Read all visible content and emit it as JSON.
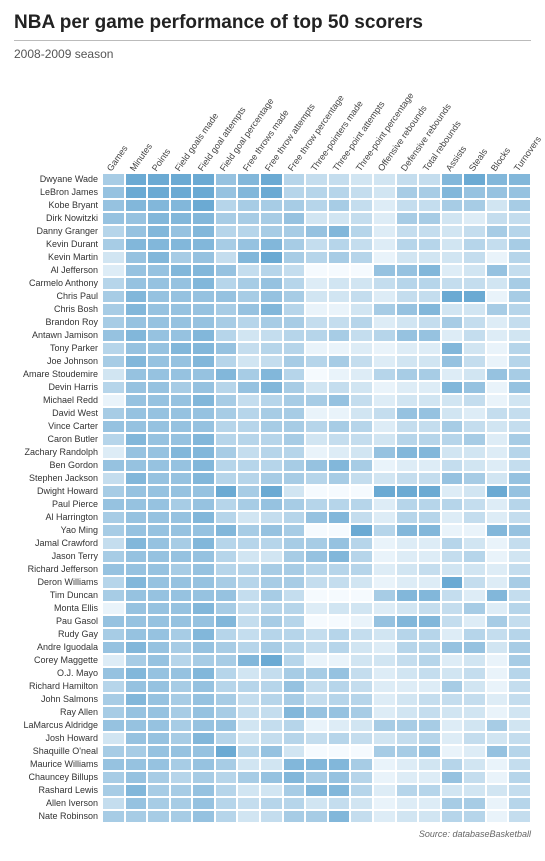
{
  "title": "NBA per game performance of top 50 scorers",
  "subtitle": "2008-2009 season",
  "source": "Source: databaseBasketball",
  "chart_data": {
    "type": "heatmap",
    "note": "Cell color encodes relative value within each column (darker = higher).",
    "value_scale": [
      0,
      1,
      2,
      3,
      4,
      5,
      6,
      7,
      8,
      9
    ],
    "colors": [
      "#f5fafe",
      "#e9f3fa",
      "#ddecf6",
      "#d1e5f2",
      "#c4ddee",
      "#b6d5ea",
      "#a7cce5",
      "#96c2e0",
      "#82b7da",
      "#6baad3"
    ],
    "columns": [
      "Games",
      "Minutes",
      "Points",
      "Field goals made",
      "Field goal attempts",
      "Field goal percentage",
      "Free throws made",
      "Free throw attempts",
      "Free throw percentage",
      "Three-pointers made",
      "Three-point attempts",
      "Three-point percentage",
      "Offensive rebounds",
      "Defensive rebounds",
      "Total rebounds",
      "Assists",
      "Steals",
      "Blocks",
      "Turnovers"
    ],
    "rows": [
      "Dwyane Wade",
      "LeBron James",
      "Kobe Bryant",
      "Dirk Nowitzki",
      "Danny Granger",
      "Kevin Durant",
      "Kevin Martin",
      "Al Jefferson",
      "Carmelo Anthony",
      "Chris Paul",
      "Chris Bosh",
      "Brandon Roy",
      "Antawn Jamison",
      "Tony Parker",
      "Joe Johnson",
      "Amare Stoudemire",
      "Devin Harris",
      "Michael Redd",
      "David West",
      "Vince Carter",
      "Caron Butler",
      "Zachary Randolph",
      "Ben Gordon",
      "Stephen Jackson",
      "Dwight Howard",
      "Paul Pierce",
      "Al Harrington",
      "Yao Ming",
      "Jamal Crawford",
      "Jason Terry",
      "Richard Jefferson",
      "Deron Williams",
      "Tim Duncan",
      "Monta Ellis",
      "Pau Gasol",
      "Rudy Gay",
      "Andre Iguodala",
      "Corey Maggette",
      "O.J. Mayo",
      "Richard Hamilton",
      "John Salmons",
      "Ray Allen",
      "LaMarcus Aldridge",
      "Josh Howard",
      "Shaquille O'neal",
      "Maurice Williams",
      "Chauncey Billups",
      "Rashard Lewis",
      "Allen Iverson",
      "Nate Robinson"
    ],
    "matrix": [
      [
        6,
        9,
        9,
        9,
        9,
        7,
        8,
        9,
        5,
        4,
        4,
        3,
        3,
        4,
        4,
        8,
        9,
        8,
        8
      ],
      [
        7,
        9,
        9,
        9,
        9,
        7,
        8,
        9,
        5,
        5,
        5,
        4,
        3,
        6,
        6,
        8,
        7,
        7,
        7
      ],
      [
        7,
        8,
        8,
        8,
        9,
        5,
        6,
        6,
        6,
        5,
        6,
        4,
        2,
        4,
        4,
        6,
        6,
        3,
        6
      ],
      [
        7,
        7,
        8,
        8,
        8,
        6,
        6,
        6,
        7,
        3,
        3,
        4,
        2,
        6,
        6,
        3,
        2,
        4,
        4
      ],
      [
        5,
        7,
        8,
        7,
        8,
        5,
        5,
        6,
        6,
        7,
        8,
        5,
        2,
        4,
        4,
        3,
        4,
        6,
        5
      ],
      [
        6,
        8,
        8,
        8,
        8,
        6,
        7,
        8,
        6,
        4,
        5,
        4,
        2,
        5,
        5,
        3,
        5,
        4,
        6
      ],
      [
        3,
        7,
        8,
        6,
        7,
        4,
        8,
        9,
        6,
        5,
        6,
        5,
        1,
        3,
        3,
        3,
        4,
        1,
        5
      ],
      [
        2,
        7,
        7,
        8,
        8,
        7,
        4,
        5,
        4,
        0,
        0,
        0,
        7,
        7,
        8,
        2,
        3,
        7,
        4
      ],
      [
        5,
        7,
        7,
        7,
        8,
        5,
        6,
        7,
        5,
        2,
        3,
        3,
        4,
        5,
        5,
        4,
        4,
        3,
        6
      ],
      [
        6,
        8,
        7,
        7,
        7,
        7,
        6,
        7,
        6,
        3,
        3,
        4,
        2,
        4,
        4,
        9,
        9,
        1,
        6
      ],
      [
        6,
        8,
        7,
        7,
        7,
        6,
        7,
        8,
        5,
        1,
        1,
        3,
        6,
        7,
        8,
        3,
        3,
        6,
        5
      ],
      [
        6,
        7,
        7,
        7,
        7,
        6,
        5,
        6,
        6,
        4,
        4,
        5,
        2,
        3,
        4,
        6,
        4,
        2,
        4
      ],
      [
        7,
        8,
        7,
        7,
        8,
        5,
        3,
        4,
        5,
        5,
        6,
        4,
        5,
        7,
        7,
        2,
        4,
        2,
        3
      ],
      [
        5,
        7,
        7,
        8,
        8,
        7,
        4,
        5,
        5,
        1,
        1,
        2,
        1,
        2,
        2,
        8,
        3,
        1,
        5
      ],
      [
        6,
        8,
        7,
        7,
        8,
        5,
        3,
        4,
        6,
        5,
        6,
        4,
        2,
        3,
        3,
        7,
        4,
        1,
        5
      ],
      [
        3,
        7,
        7,
        7,
        7,
        8,
        6,
        8,
        5,
        0,
        1,
        2,
        5,
        6,
        6,
        2,
        3,
        7,
        6
      ],
      [
        5,
        7,
        7,
        6,
        7,
        5,
        7,
        8,
        6,
        3,
        4,
        3,
        1,
        2,
        2,
        8,
        7,
        1,
        7
      ],
      [
        1,
        7,
        7,
        7,
        8,
        6,
        4,
        5,
        6,
        6,
        7,
        4,
        2,
        3,
        3,
        3,
        4,
        1,
        3
      ],
      [
        6,
        7,
        7,
        7,
        7,
        6,
        5,
        6,
        6,
        1,
        1,
        3,
        4,
        7,
        7,
        3,
        2,
        4,
        4
      ],
      [
        7,
        7,
        7,
        7,
        7,
        5,
        5,
        6,
        6,
        5,
        6,
        5,
        2,
        4,
        4,
        6,
        4,
        3,
        4
      ],
      [
        5,
        8,
        7,
        7,
        8,
        5,
        5,
        5,
        6,
        3,
        4,
        4,
        3,
        5,
        5,
        5,
        6,
        2,
        6
      ],
      [
        2,
        7,
        7,
        8,
        8,
        6,
        4,
        5,
        5,
        1,
        2,
        3,
        7,
        8,
        8,
        3,
        3,
        2,
        5
      ],
      [
        7,
        7,
        7,
        7,
        8,
        5,
        5,
        5,
        6,
        7,
        8,
        6,
        1,
        2,
        2,
        4,
        3,
        2,
        4
      ],
      [
        4,
        8,
        7,
        7,
        8,
        5,
        5,
        6,
        6,
        5,
        6,
        4,
        3,
        4,
        4,
        7,
        6,
        3,
        7
      ],
      [
        6,
        7,
        7,
        7,
        7,
        9,
        6,
        9,
        3,
        0,
        0,
        0,
        9,
        9,
        9,
        2,
        3,
        9,
        7
      ],
      [
        7,
        7,
        7,
        6,
        7,
        5,
        6,
        7,
        6,
        5,
        5,
        5,
        2,
        5,
        5,
        5,
        4,
        2,
        5
      ],
      [
        6,
        7,
        7,
        7,
        8,
        5,
        3,
        4,
        5,
        7,
        8,
        4,
        2,
        5,
        5,
        2,
        4,
        2,
        4
      ],
      [
        6,
        7,
        7,
        7,
        7,
        8,
        6,
        7,
        6,
        0,
        0,
        9,
        5,
        8,
        8,
        1,
        1,
        8,
        7
      ],
      [
        4,
        8,
        7,
        6,
        8,
        5,
        5,
        5,
        6,
        6,
        7,
        5,
        1,
        2,
        2,
        5,
        3,
        1,
        4
      ],
      [
        6,
        7,
        7,
        7,
        7,
        5,
        3,
        3,
        6,
        7,
        8,
        5,
        1,
        2,
        2,
        4,
        5,
        1,
        3
      ],
      [
        7,
        7,
        7,
        6,
        7,
        5,
        5,
        6,
        6,
        5,
        5,
        5,
        2,
        3,
        4,
        3,
        3,
        2,
        4
      ],
      [
        5,
        8,
        7,
        7,
        7,
        6,
        5,
        6,
        6,
        4,
        4,
        3,
        1,
        2,
        2,
        9,
        4,
        2,
        6
      ],
      [
        6,
        7,
        7,
        7,
        7,
        7,
        4,
        6,
        4,
        0,
        0,
        0,
        6,
        8,
        8,
        4,
        2,
        8,
        4
      ],
      [
        1,
        7,
        7,
        7,
        8,
        6,
        4,
        5,
        5,
        2,
        3,
        3,
        2,
        3,
        4,
        4,
        6,
        2,
        5
      ],
      [
        7,
        7,
        7,
        7,
        7,
        8,
        4,
        6,
        5,
        0,
        0,
        1,
        7,
        8,
        8,
        4,
        2,
        6,
        4
      ],
      [
        6,
        7,
        7,
        6,
        8,
        5,
        4,
        5,
        5,
        4,
        5,
        4,
        3,
        5,
        5,
        2,
        5,
        4,
        5
      ],
      [
        7,
        8,
        7,
        6,
        7,
        6,
        5,
        6,
        5,
        4,
        5,
        3,
        2,
        5,
        5,
        7,
        7,
        3,
        6
      ],
      [
        2,
        6,
        7,
        5,
        6,
        6,
        8,
        9,
        5,
        1,
        1,
        3,
        3,
        4,
        5,
        2,
        3,
        1,
        6
      ],
      [
        7,
        8,
        7,
        7,
        8,
        5,
        3,
        4,
        6,
        6,
        7,
        4,
        2,
        3,
        4,
        3,
        4,
        1,
        5
      ],
      [
        5,
        7,
        7,
        6,
        7,
        5,
        5,
        5,
        7,
        4,
        5,
        4,
        2,
        2,
        2,
        6,
        3,
        1,
        4
      ],
      [
        6,
        8,
        7,
        6,
        7,
        6,
        4,
        5,
        6,
        4,
        5,
        5,
        2,
        3,
        4,
        4,
        4,
        2,
        4
      ],
      [
        6,
        7,
        7,
        6,
        7,
        6,
        4,
        4,
        8,
        7,
        7,
        6,
        2,
        3,
        4,
        3,
        3,
        1,
        3
      ],
      [
        7,
        7,
        7,
        6,
        7,
        7,
        3,
        4,
        5,
        1,
        2,
        3,
        6,
        6,
        6,
        2,
        3,
        6,
        3
      ],
      [
        3,
        7,
        7,
        6,
        8,
        5,
        3,
        4,
        5,
        4,
        5,
        4,
        3,
        4,
        5,
        2,
        4,
        3,
        4
      ],
      [
        6,
        6,
        7,
        7,
        7,
        9,
        5,
        7,
        3,
        0,
        0,
        0,
        6,
        6,
        7,
        1,
        2,
        7,
        5
      ],
      [
        7,
        7,
        7,
        6,
        7,
        6,
        3,
        3,
        8,
        8,
        8,
        6,
        1,
        2,
        3,
        5,
        3,
        1,
        4
      ],
      [
        6,
        7,
        6,
        5,
        6,
        5,
        6,
        7,
        8,
        6,
        7,
        5,
        1,
        2,
        2,
        7,
        4,
        1,
        5
      ],
      [
        6,
        8,
        6,
        6,
        7,
        5,
        3,
        3,
        6,
        8,
        8,
        5,
        2,
        5,
        5,
        3,
        3,
        3,
        4
      ],
      [
        4,
        7,
        6,
        6,
        7,
        5,
        4,
        5,
        5,
        3,
        4,
        3,
        1,
        2,
        2,
        6,
        6,
        1,
        5
      ],
      [
        6,
        6,
        6,
        6,
        7,
        5,
        3,
        4,
        6,
        6,
        8,
        4,
        2,
        3,
        3,
        5,
        5,
        1,
        4
      ]
    ]
  }
}
